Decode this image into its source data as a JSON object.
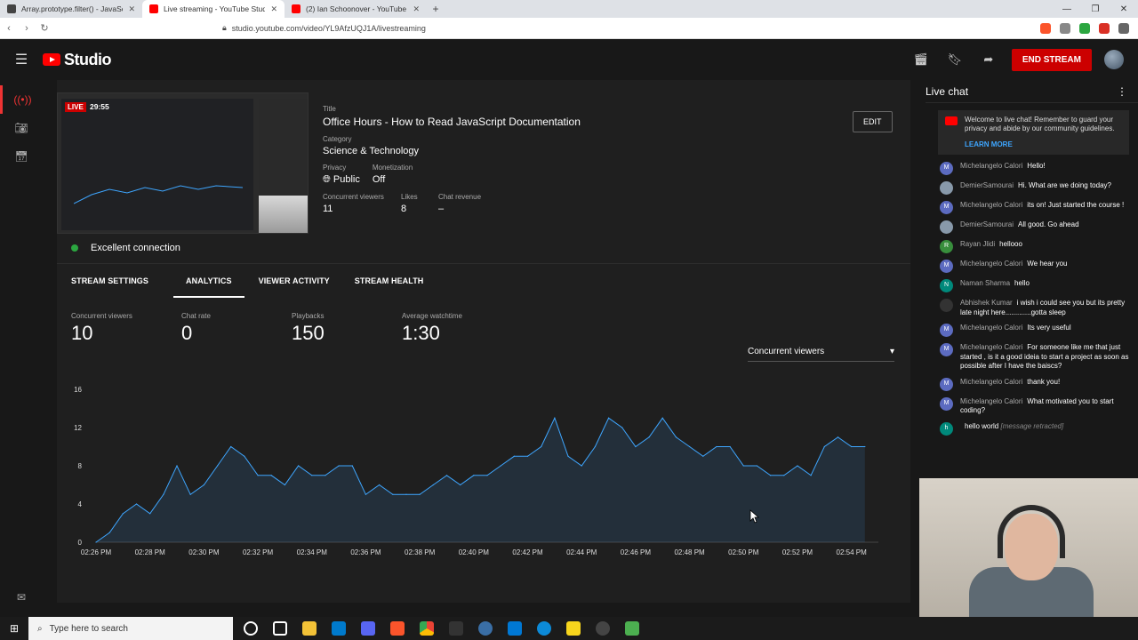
{
  "browser": {
    "tabs": [
      {
        "label": "Array.prototype.filter() - JavaScript | M",
        "color": "#444444",
        "active": false
      },
      {
        "label": "Live streaming - YouTube Studio",
        "color": "#ff0000",
        "active": true
      },
      {
        "label": "(2) Ian Schoonover - YouTube",
        "color": "#ff0000",
        "active": false
      }
    ],
    "url": "studio.youtube.com/video/YL9AfzUQJ1A/livestreaming"
  },
  "header": {
    "logo_text": "Studio",
    "end_stream_label": "END STREAM"
  },
  "stream": {
    "live_label": "LIVE",
    "elapsed": "29:55",
    "title_label": "Title",
    "title": "Office Hours - How to Read JavaScript Documentation",
    "category_label": "Category",
    "category": "Science & Technology",
    "privacy_label": "Privacy",
    "privacy": "Public",
    "monetization_label": "Monetization",
    "monetization": "Off",
    "concurrent_label": "Concurrent viewers",
    "concurrent": "11",
    "likes_label": "Likes",
    "likes": "8",
    "chat_revenue_label": "Chat revenue",
    "chat_revenue": "–",
    "edit_label": "EDIT",
    "connection": "Excellent connection"
  },
  "tabs": [
    {
      "label": "STREAM SETTINGS",
      "active": false
    },
    {
      "label": "ANALYTICS",
      "active": true
    },
    {
      "label": "VIEWER ACTIVITY",
      "active": false
    },
    {
      "label": "STREAM HEALTH",
      "active": false
    }
  ],
  "metrics": [
    {
      "label": "Concurrent viewers",
      "value": "10"
    },
    {
      "label": "Chat rate",
      "value": "0"
    },
    {
      "label": "Playbacks",
      "value": "150"
    },
    {
      "label": "Average watchtime",
      "value": "1:30"
    }
  ],
  "dropdown": {
    "selected": "Concurrent viewers"
  },
  "chart_data": {
    "type": "area",
    "title": "",
    "xlabel": "",
    "ylabel": "",
    "ylim": [
      0,
      16
    ],
    "yticks": [
      0,
      4,
      8,
      12,
      16
    ],
    "x_tick_labels": [
      "02:26 PM",
      "02:28 PM",
      "02:30 PM",
      "02:32 PM",
      "02:34 PM",
      "02:36 PM",
      "02:38 PM",
      "02:40 PM",
      "02:42 PM",
      "02:44 PM",
      "02:46 PM",
      "02:48 PM",
      "02:50 PM",
      "02:52 PM",
      "02:54 PM"
    ],
    "x_range_minutes": [
      0,
      29
    ],
    "series": [
      {
        "points": [
          [
            0,
            0
          ],
          [
            0.5,
            1
          ],
          [
            1,
            3
          ],
          [
            1.5,
            4
          ],
          [
            2,
            3
          ],
          [
            2.5,
            5
          ],
          [
            3,
            8
          ],
          [
            3.5,
            5
          ],
          [
            4,
            6
          ],
          [
            4.5,
            8
          ],
          [
            5,
            10
          ],
          [
            5.5,
            9
          ],
          [
            6,
            7
          ],
          [
            6.5,
            7
          ],
          [
            7,
            6
          ],
          [
            7.5,
            8
          ],
          [
            8,
            7
          ],
          [
            8.5,
            7
          ],
          [
            9,
            8
          ],
          [
            9.5,
            8
          ],
          [
            10,
            5
          ],
          [
            10.5,
            6
          ],
          [
            11,
            5
          ],
          [
            11.5,
            5
          ],
          [
            12,
            5
          ],
          [
            12.5,
            6
          ],
          [
            13,
            7
          ],
          [
            13.5,
            6
          ],
          [
            14,
            7
          ],
          [
            14.5,
            7
          ],
          [
            15,
            8
          ],
          [
            15.5,
            9
          ],
          [
            16,
            9
          ],
          [
            16.5,
            10
          ],
          [
            17,
            13
          ],
          [
            17.5,
            9
          ],
          [
            18,
            8
          ],
          [
            18.5,
            10
          ],
          [
            19,
            13
          ],
          [
            19.5,
            12
          ],
          [
            20,
            10
          ],
          [
            20.5,
            11
          ],
          [
            21,
            13
          ],
          [
            21.5,
            11
          ],
          [
            22,
            10
          ],
          [
            22.5,
            9
          ],
          [
            23,
            10
          ],
          [
            23.5,
            10
          ],
          [
            24,
            8
          ],
          [
            24.5,
            8
          ],
          [
            25,
            7
          ],
          [
            25.5,
            7
          ],
          [
            26,
            8
          ],
          [
            26.5,
            7
          ],
          [
            27,
            10
          ],
          [
            27.5,
            11
          ],
          [
            28,
            10
          ],
          [
            28.5,
            10
          ]
        ]
      }
    ],
    "grid": false,
    "legend": "none",
    "colors": {
      "line": "#3ea6ff",
      "fill": "#3ea6ff"
    }
  },
  "chat": {
    "title": "Live chat",
    "welcome": "Welcome to live chat! Remember to guard your privacy and abide by our community guidelines.",
    "learn_more": "LEARN MORE",
    "messages": [
      {
        "author": "Michelangelo Calori",
        "text": "Hello!",
        "avatar": "M",
        "color": "#5c6bc0"
      },
      {
        "author": "DemierSamourai",
        "text": "Hi. What are we doing today?",
        "avatar": "",
        "color": "#8899aa"
      },
      {
        "author": "Michelangelo Calori",
        "text": "its on! Just started the course !",
        "avatar": "M",
        "color": "#5c6bc0"
      },
      {
        "author": "DemierSamourai",
        "text": "All good. Go ahead",
        "avatar": "",
        "color": "#8899aa"
      },
      {
        "author": "Rayan Jlidi",
        "text": "hellooo",
        "avatar": "R",
        "color": "#388e3c"
      },
      {
        "author": "Michelangelo Calori",
        "text": "We hear you",
        "avatar": "M",
        "color": "#5c6bc0"
      },
      {
        "author": "Naman Sharma",
        "text": "hello",
        "avatar": "N",
        "color": "#00897b"
      },
      {
        "author": "Abhishek Kumar",
        "text": "i wish i could see you but its pretty late night here.............gotta sleep",
        "avatar": "",
        "color": "#333333"
      },
      {
        "author": "Michelangelo Calori",
        "text": "Its very useful",
        "avatar": "M",
        "color": "#5c6bc0"
      },
      {
        "author": "Michelangelo Calori",
        "text": "For someone like me that just started , is it a good ideia to start a project as soon as possible after I have the baiscs?",
        "avatar": "M",
        "color": "#5c6bc0"
      },
      {
        "author": "Michelangelo Calori",
        "text": "thank you!",
        "avatar": "M",
        "color": "#5c6bc0"
      },
      {
        "author": "Michelangelo Calori",
        "text": "What motivated you to start coding?",
        "avatar": "M",
        "color": "#5c6bc0"
      },
      {
        "author": "",
        "text": "hello world",
        "retracted": "[message retracted]",
        "avatar": "h",
        "color": "#00897b"
      }
    ]
  },
  "taskbar": {
    "search_placeholder": "Type here to search"
  }
}
